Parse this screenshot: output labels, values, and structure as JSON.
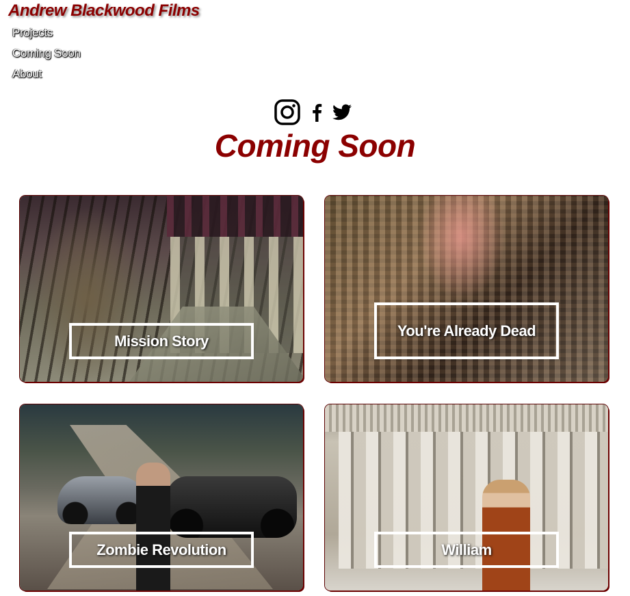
{
  "site": {
    "brand": "Andrew Blackwood Films"
  },
  "nav": {
    "items": [
      {
        "label": "Projects"
      },
      {
        "label": "Coming Soon"
      },
      {
        "label": "About"
      }
    ]
  },
  "social": {
    "icons": [
      "instagram-icon",
      "facebook-icon",
      "twitter-icon"
    ]
  },
  "page": {
    "title": "Coming Soon"
  },
  "colors": {
    "brand": "#8b0000",
    "background": "#ffffff",
    "label": "#ffffff"
  },
  "projects": [
    {
      "title": "Mission Story"
    },
    {
      "title": "You're Already Dead"
    },
    {
      "title": "Zombie Revolution"
    },
    {
      "title": "William"
    }
  ]
}
